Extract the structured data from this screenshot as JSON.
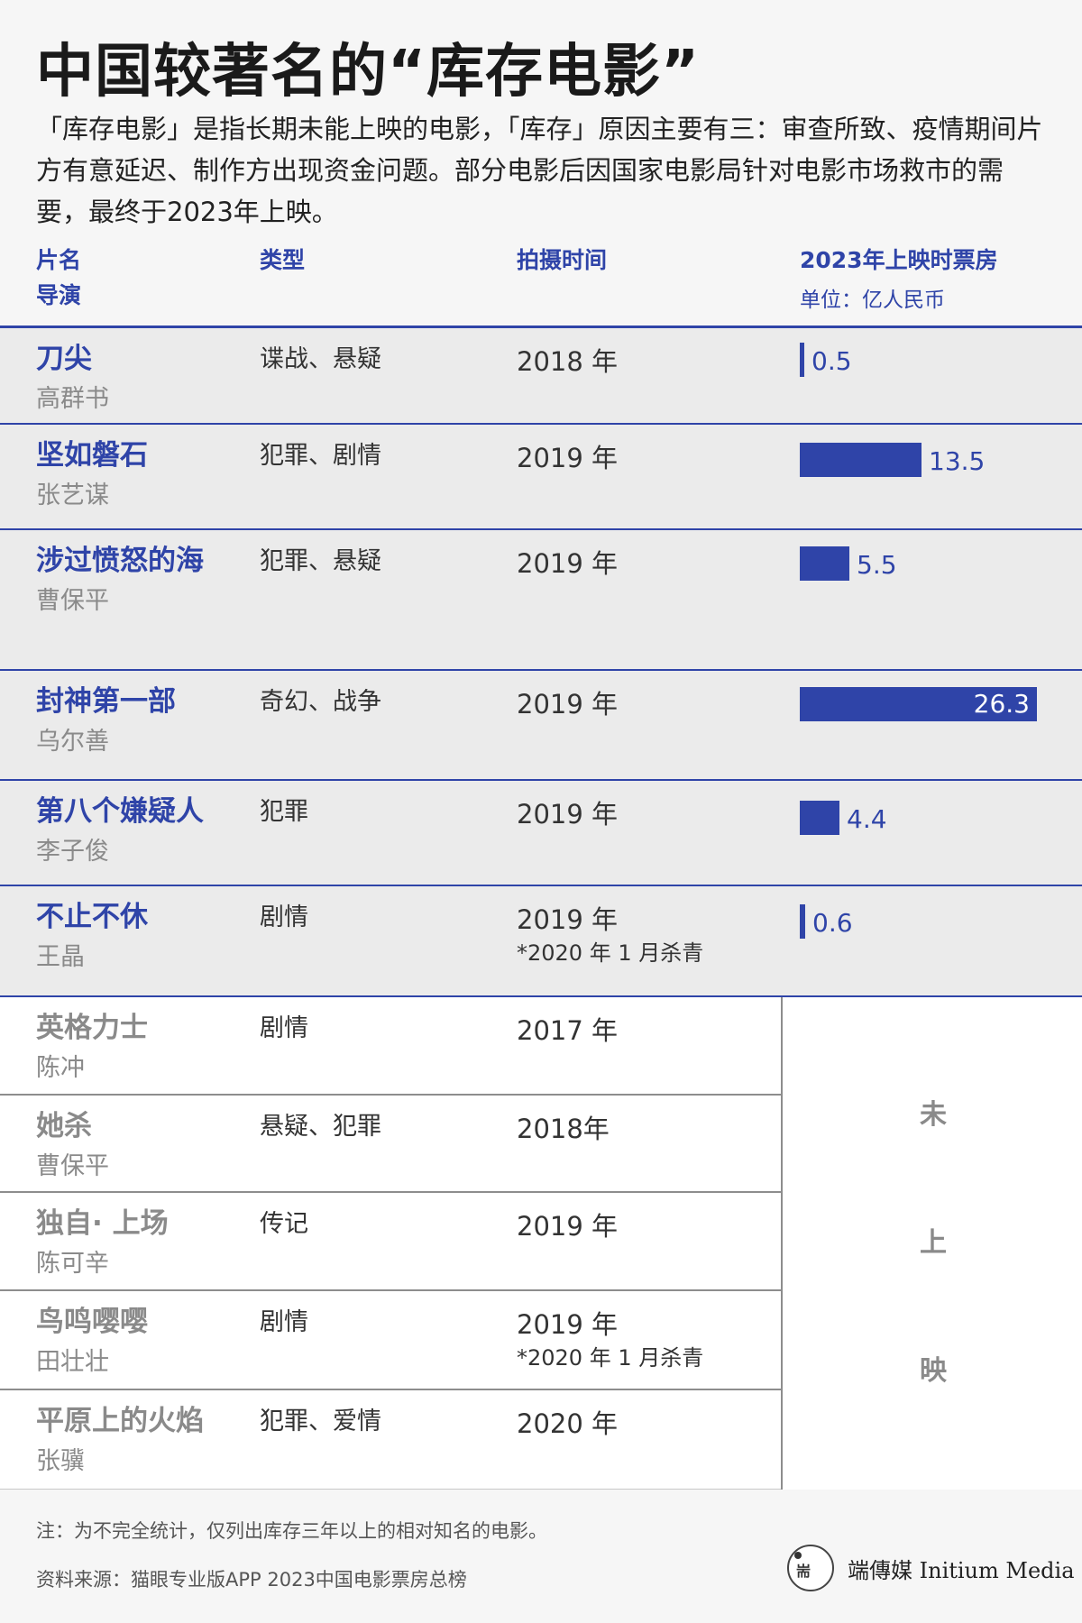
{
  "title": "中国较著名的“库存电影”",
  "intro": "「库存电影」是指长期未能上映的电影，「库存」原因主要有三：审查所致、疫情期间片方有意延迟、制作方出现资金问题。部分电影后因国家电影局针对电影市场救市的需要，最终于2023年上映。",
  "headers": {
    "title": "片名",
    "director": "导演",
    "genre": "类型",
    "shoot_time": "拍摄时间",
    "box_office": "2023年上映时票房",
    "unit": "单位：亿人民币"
  },
  "chart_data": {
    "type": "bar",
    "orientation": "horizontal",
    "title": "2023年上映时票房",
    "unit": "单位：亿人民币",
    "categories": [
      "刀尖",
      "坚如磐石",
      "涉过愤怒的海",
      "封神第一部",
      "第八个嫌疑人",
      "不止不休"
    ],
    "values": [
      0.5,
      13.5,
      5.5,
      26.3,
      4.4,
      0.6
    ],
    "xlim": [
      0,
      26.3
    ],
    "color": "#2f44a8"
  },
  "released": [
    {
      "title": "刀尖",
      "director": "高群书",
      "genre": "谍战、悬疑",
      "year": "2018 年",
      "note": "",
      "box": 0.5
    },
    {
      "title": "坚如磐石",
      "director": "张艺谋",
      "genre": "犯罪、剧情",
      "year": "2019 年",
      "note": "",
      "box": 13.5
    },
    {
      "title": "涉过愤怒的海",
      "director": "曹保平",
      "genre": "犯罪、悬疑",
      "year": "2019 年",
      "note": "",
      "box": 5.5
    },
    {
      "title": "封神第一部",
      "director": "乌尔善",
      "genre": "奇幻、战争",
      "year": "2019 年",
      "note": "",
      "box": 26.3
    },
    {
      "title": "第八个嫌疑人",
      "director": "李子俊",
      "genre": "犯罪",
      "year": "2019 年",
      "note": "",
      "box": 4.4
    },
    {
      "title": "不止不休",
      "director": "王晶",
      "genre": "剧情",
      "year": "2019 年",
      "note": "*2020 年 1 月杀青",
      "box": 0.6
    }
  ],
  "unreleased": [
    {
      "title": "英格力士",
      "director": "陈冲",
      "genre": "剧情",
      "year": "2017 年",
      "note": ""
    },
    {
      "title": "她杀",
      "director": "曹保平",
      "genre": "悬疑、犯罪",
      "year": "2018年",
      "note": ""
    },
    {
      "title": "独自· 上场",
      "director": "陈可辛",
      "genre": "传记",
      "year": "2019 年",
      "note": ""
    },
    {
      "title": "鸟鸣嘤嘤",
      "director": "田壮壮",
      "genre": "剧情",
      "year": "2019 年",
      "note": "*2020 年 1 月杀青"
    },
    {
      "title": "平原上的火焰",
      "director": "张骥",
      "genre": "犯罪、爱情",
      "year": "2020 年",
      "note": ""
    }
  ],
  "unreleased_label": [
    "未",
    "上",
    "映"
  ],
  "footer": {
    "note": "注：为不完全统计，仅列出库存三年以上的相对知名的电影。",
    "source": "资料来源：猫眼专业版APP 2023中国电影票房总榜",
    "logo_text": "端傳媒 Initium Media",
    "logo_glyph": "耑"
  }
}
